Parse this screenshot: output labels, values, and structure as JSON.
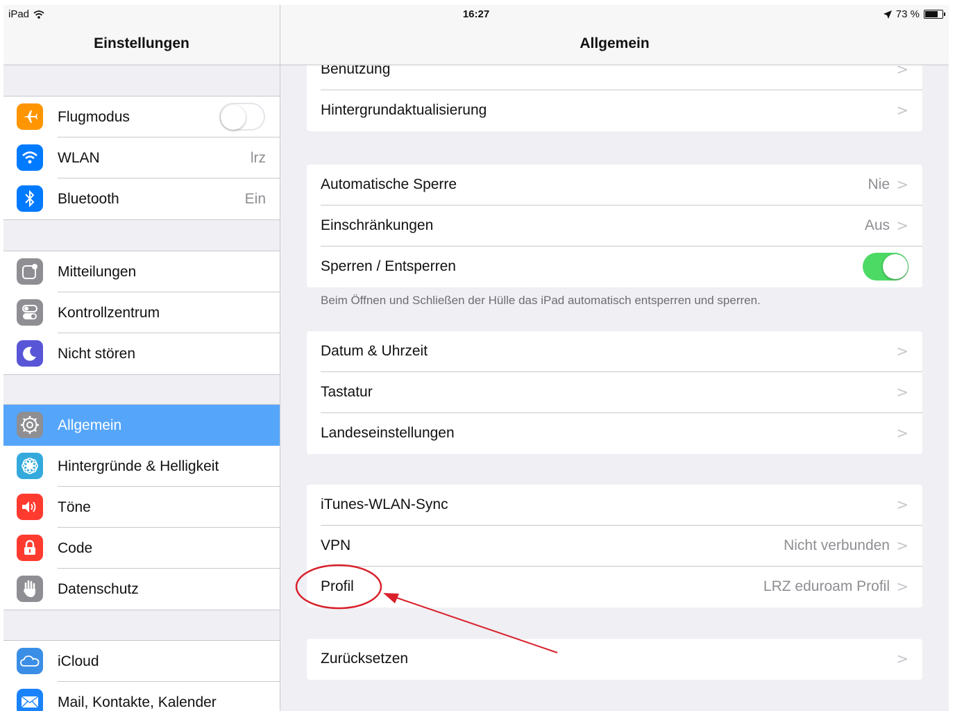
{
  "status_bar": {
    "device": "iPad",
    "time": "16:27",
    "battery": "73 %",
    "battery_level": 0.73
  },
  "sidebar": {
    "title": "Einstellungen",
    "groups": [
      [
        {
          "label": "Flugmodus",
          "icon": "airplane-icon",
          "color": "#ff9500"
        },
        {
          "label": "WLAN",
          "value": "lrz",
          "icon": "wifi-icon",
          "color": "#007aff"
        },
        {
          "label": "Bluetooth",
          "value": "Ein",
          "icon": "bluetooth-icon",
          "color": "#007aff"
        }
      ],
      [
        {
          "label": "Mitteilungen",
          "icon": "notifications-icon",
          "color": "#8e8e93"
        },
        {
          "label": "Kontrollzentrum",
          "icon": "control-center-icon",
          "color": "#8e8e93"
        },
        {
          "label": "Nicht stören",
          "icon": "moon-icon",
          "color": "#5856d6"
        }
      ],
      [
        {
          "label": "Allgemein",
          "icon": "gear-icon",
          "color": "#8e8e93",
          "selected": true
        },
        {
          "label": "Hintergründe & Helligkeit",
          "icon": "flower-icon",
          "color": "#34aadc"
        },
        {
          "label": "Töne",
          "icon": "speaker-icon",
          "color": "#ff3b30"
        },
        {
          "label": "Code",
          "icon": "lock-icon",
          "color": "#ff3b30"
        },
        {
          "label": "Datenschutz",
          "icon": "hand-icon",
          "color": "#8e8e93"
        }
      ],
      [
        {
          "label": "iCloud",
          "icon": "cloud-icon",
          "color": "#3a8ee6"
        },
        {
          "label": "Mail, Kontakte, Kalender",
          "icon": "mail-icon",
          "color": "#1a82fb"
        }
      ]
    ]
  },
  "detail": {
    "title": "Allgemein",
    "group1": [
      {
        "label": "Benutzung"
      },
      {
        "label": "Hintergrundaktualisierung"
      }
    ],
    "group2": [
      {
        "label": "Automatische Sperre",
        "value": "Nie"
      },
      {
        "label": "Einschränkungen",
        "value": "Aus"
      },
      {
        "label": "Sperren / Entsperren"
      }
    ],
    "group2_footer": "Beim Öffnen und Schließen der Hülle das iPad automatisch entsperren und sperren.",
    "group3": [
      {
        "label": "Datum & Uhrzeit"
      },
      {
        "label": "Tastatur"
      },
      {
        "label": "Landeseinstellungen"
      }
    ],
    "group4": [
      {
        "label": "iTunes-WLAN-Sync"
      },
      {
        "label": "VPN",
        "value": "Nicht verbunden"
      },
      {
        "label": "Profil",
        "value": "LRZ eduroam Profil"
      }
    ],
    "group5": [
      {
        "label": "Zurücksetzen"
      }
    ]
  },
  "toggles": {
    "flugmodus": false,
    "sperren_entsperren": true
  },
  "annotation_color": "#d9202a"
}
